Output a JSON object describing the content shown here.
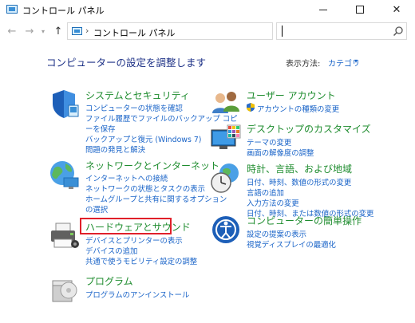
{
  "window": {
    "title": "コントロール パネル"
  },
  "address": {
    "path": "コントロール パネル"
  },
  "header": {
    "title": "コンピューターの設定を調整します",
    "view_by_label": "表示方法:",
    "view_by_value": "カテゴリ"
  },
  "left": [
    {
      "title": "システムとセキュリティ",
      "links": [
        "コンピューターの状態を確認",
        "ファイル履歴でファイルのバックアップ コピ",
        "ーを保存",
        "バックアップと復元 (Windows 7)",
        "問題の発見と解決"
      ]
    },
    {
      "title": "ネットワークとインターネット",
      "links": [
        "インターネットへの接続",
        "ネットワークの状態とタスクの表示",
        "ホームグループと共有に関するオプション",
        "の選択"
      ]
    },
    {
      "title": "ハードウェアとサウンド",
      "links": [
        "デバイスとプリンターの表示",
        "デバイスの追加",
        "共通で使うモビリティ設定の調整"
      ]
    },
    {
      "title": "プログラム",
      "links": [
        "プログラムのアンインストール"
      ]
    }
  ],
  "right": [
    {
      "title": "ユーザー アカウント",
      "links": [
        "アカウントの種類の変更"
      ]
    },
    {
      "title": "デスクトップのカスタマイズ",
      "links": [
        "テーマの変更",
        "画面の解像度の調整"
      ]
    },
    {
      "title": "時計、言語、および地域",
      "links": [
        "日付、時刻、数値の形式の変更",
        "言語の追加",
        "入力方法の変更",
        "日付、時刻、または数値の形式の変更"
      ]
    },
    {
      "title": "コンピューターの簡単操作",
      "links": [
        "設定の提案の表示",
        "視覚ディスプレイの最適化"
      ]
    }
  ],
  "colors": {
    "category_title": "#1e8c2e",
    "link": "#1a64c8",
    "page_title": "#1e3287",
    "highlight": "#e0202a"
  }
}
